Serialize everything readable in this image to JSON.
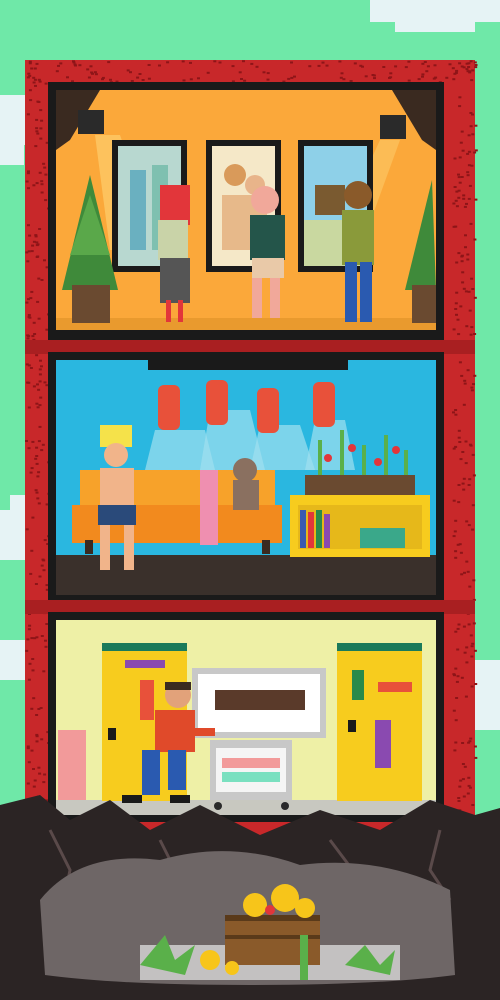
{
  "scene": {
    "colors": {
      "sky": "#6fe8a8",
      "cloud": "#e6f3f5",
      "building_wall": "#c8282a",
      "building_speckle": "#8e1518",
      "floor_divider": "#a91f21",
      "room_frame": "#1a1a1a",
      "gallery_wall": "#fba83a",
      "gallery_floor": "#e99a2e",
      "lounge_wall": "#2ab7e0",
      "lounge_floor": "#3a302b",
      "office_wall": "#eef0a6",
      "office_floor": "#c8c8c0",
      "dirt": "#2b2424",
      "cave": "#6e6666",
      "gold": "#f7c51a",
      "sofa": "#f28a1e",
      "punching_bag": "#e8513a",
      "door": "#f7cc1e",
      "plant": "#3f8a3a"
    },
    "icons": [
      "cloud-icon",
      "spotlight-icon",
      "framed-painting-icon",
      "potted-tree-icon",
      "punching-bag-icon",
      "sofa-icon",
      "teddy-bear-icon",
      "bookshelf-icon",
      "flower-planter-icon",
      "door-icon",
      "whiteboard-icon",
      "cart-icon",
      "treasure-chest-icon",
      "gold-coin-icon"
    ]
  }
}
